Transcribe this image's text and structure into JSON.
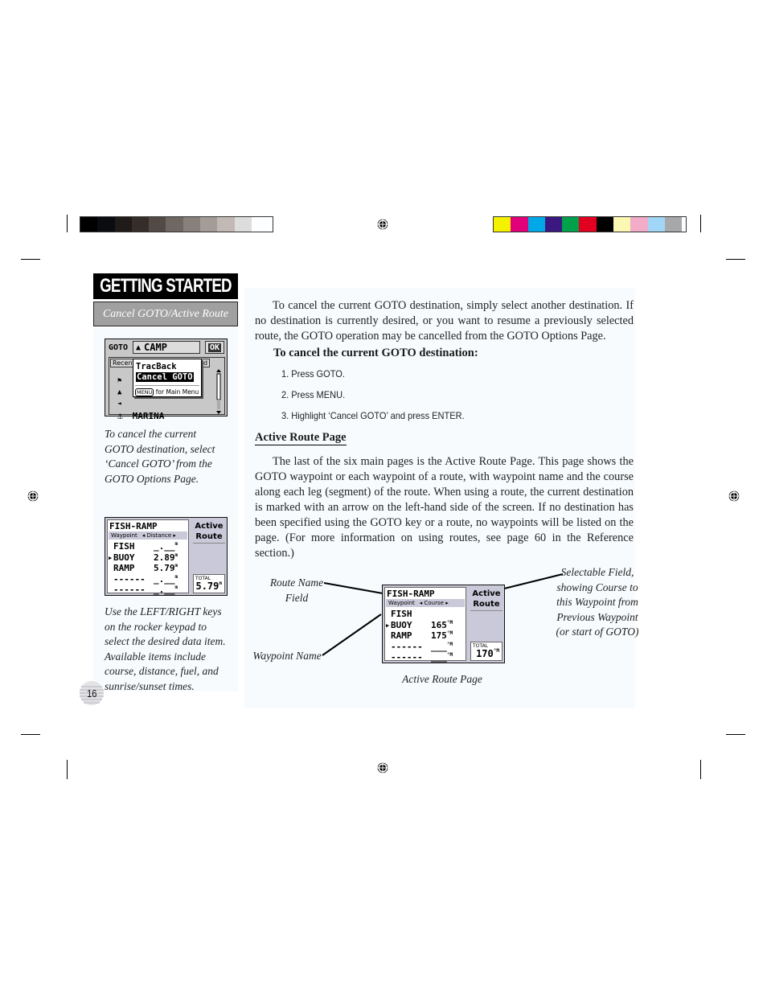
{
  "print_marks": {
    "grayscale_swatches": [
      "#000000",
      "#0a0c10",
      "#201a18",
      "#352d2a",
      "#544a45",
      "#6e6762",
      "#87807b",
      "#a39c97",
      "#c2b9b4",
      "#dedddd",
      "#fdfeff"
    ],
    "color_swatches": [
      "#f5f200",
      "#e2007a",
      "#00a8e8",
      "#3a1880",
      "#00a14b",
      "#e1001f",
      "#000000",
      "#fbf8b3",
      "#f3acc8",
      "#a1d6f6",
      "#a6a8aa"
    ]
  },
  "sidebar": {
    "section_title": "GETTING STARTED",
    "subsection_title": "Cancel GOTO/Active Route",
    "caption_1": "To cancel the current GOTO destination, select ‘Cancel GOTO’ from the GOTO Options Page.",
    "caption_2": "Use the LEFT/RIGHT keys on the rocker keypad to select the desired data item. Available items include course, distance, fuel, and sunrise/sunset times.",
    "page_number": "16"
  },
  "goto_screen": {
    "label": "GOTO",
    "destination_icon": "campsite-icon",
    "destination": "CAMP",
    "ok_button": "OK",
    "tab_left": "Recent",
    "tab_right": "d",
    "list": [
      {
        "icon": "flag-icon",
        "name": ""
      },
      {
        "icon": "campsite-icon",
        "name": ""
      },
      {
        "icon": "fish-icon",
        "name": ""
      },
      {
        "icon": "anchor-icon",
        "name": "MARINA"
      }
    ],
    "popup": {
      "items": [
        "TracBack",
        "Cancel GOTO"
      ],
      "selected_index": 1,
      "hint_key": "MENU",
      "hint_text": "for Main Menu"
    }
  },
  "active_route_distance": {
    "route_name": "FISH-RAMP",
    "col_waypoint": "Waypoint",
    "col_field": "Distance",
    "side_title_1": "Active",
    "side_title_2": "Route",
    "rows": [
      {
        "name": "FISH",
        "value": "_.__",
        "unit": "m",
        "active": false
      },
      {
        "name": "BUOY",
        "value": "2.89",
        "unit": "m",
        "active": true
      },
      {
        "name": "RAMP",
        "value": "5.79",
        "unit": "m",
        "active": false
      },
      {
        "name": "------",
        "value": "_.__",
        "unit": "m",
        "active": false
      },
      {
        "name": "------",
        "value": "_.__",
        "unit": "m",
        "active": false
      }
    ],
    "total_label": "TOTAL",
    "total_value": "5.79",
    "total_unit": "m"
  },
  "active_route_course": {
    "route_name": "FISH-RAMP",
    "col_waypoint": "Waypoint",
    "col_field": "Course",
    "side_title_1": "Active",
    "side_title_2": "Route",
    "rows": [
      {
        "name": "FISH",
        "value": "",
        "unit": "",
        "active": false
      },
      {
        "name": "BUOY",
        "value": "165",
        "unit": "°M",
        "active": true
      },
      {
        "name": "RAMP",
        "value": "175",
        "unit": "°M",
        "active": false
      },
      {
        "name": "------",
        "value": "___",
        "unit": "°M",
        "active": false
      },
      {
        "name": "------",
        "value": "___",
        "unit": "°M",
        "active": false
      }
    ],
    "total_label": "TOTAL",
    "total_value": "170",
    "total_unit": "°M"
  },
  "main": {
    "intro_paragraph": "To cancel the current GOTO destination, simply select another destination.  If no destination is currently desired, or you want to resume a previously selected route, the GOTO operation may be cancelled from the GOTO Options Page.",
    "procedure_heading": "To cancel the current GOTO destination:",
    "steps": [
      "1. Press GOTO.",
      "2. Press MENU.",
      "3. Highlight ‘Cancel GOTO’ and press ENTER."
    ],
    "section_heading": "Active Route Page",
    "section_paragraph": "The last of the six main pages is the Active Route Page. This page shows the GOTO waypoint or each waypoint of a route, with waypoint name and the course along each leg (segment) of the route. When using a route, the current destination is marked with an arrow on the left-hand side of the screen. If no destination has been specified using the GOTO key or a route, no waypoints will be listed on the page. (For more information on using routes, see page 60 in the Reference section.)",
    "callout_route_name_1": "Route Name",
    "callout_route_name_2": "Field",
    "callout_waypoint_name": "Waypoint Name",
    "callout_selectable": [
      "Selectable Field,",
      "showing Course to",
      "this Waypoint from",
      "Previous Waypoint",
      "(or start of GOTO)"
    ],
    "figure_caption": "Active Route Page"
  }
}
